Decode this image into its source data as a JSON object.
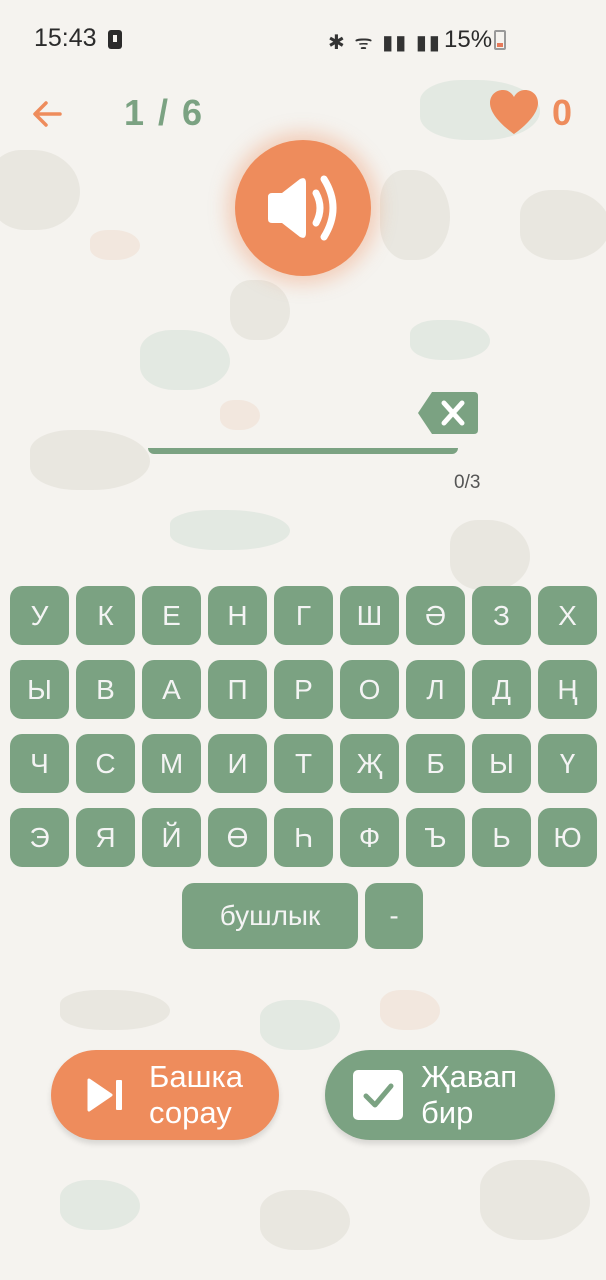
{
  "status_bar": {
    "time": "15:43",
    "icons": "✱ ᯤ ▮▮ ▮▮",
    "battery": "15%"
  },
  "header": {
    "progress": "1 / 6",
    "lives": "0",
    "accent_color": "#ee8c5c",
    "green_color": "#7ba282"
  },
  "answer": {
    "counter": "0/3"
  },
  "keyboard": {
    "rows": [
      [
        "У",
        "К",
        "Е",
        "Н",
        "Г",
        "Ш",
        "Ә",
        "З",
        "Х"
      ],
      [
        "Ы",
        "В",
        "А",
        "П",
        "Р",
        "О",
        "Л",
        "Д",
        "Ң"
      ],
      [
        "Ч",
        "С",
        "М",
        "И",
        "Т",
        "Җ",
        "Б",
        "Ы",
        "Ү"
      ],
      [
        "Э",
        "Я",
        "Й",
        "Ө",
        "Һ",
        "Ф",
        "Ъ",
        "Ь",
        "Ю"
      ]
    ],
    "space_label": "бушлык",
    "dash_label": "-"
  },
  "buttons": {
    "skip_label": "Башка\nсорау",
    "answer_label": "Җавап\nбир"
  }
}
